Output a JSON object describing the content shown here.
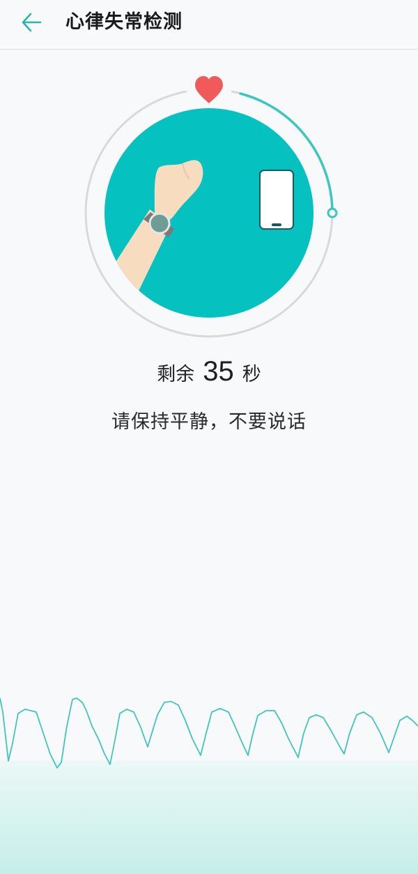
{
  "header": {
    "title": "心律失常检测",
    "back_icon": "arrow-left-icon"
  },
  "illustration": {
    "heart_icon": "heart-icon",
    "wrist_icon": "wrist-watch-icon",
    "phone_icon": "phone-icon",
    "progress_fraction": 0.25,
    "accent_color": "#05c1bf",
    "heart_color": "#f05a5a",
    "ring_color": "#d7d9dd",
    "skin_color": "#f7dcc0"
  },
  "countdown": {
    "label": "剩余",
    "value": "35",
    "unit": "秒"
  },
  "instruction": {
    "text": "请保持平静，不要说话"
  },
  "waveform": {
    "color": "#41c4bd",
    "fill_top": "#ebf8f7",
    "fill_bottom": "#c9efeb"
  }
}
